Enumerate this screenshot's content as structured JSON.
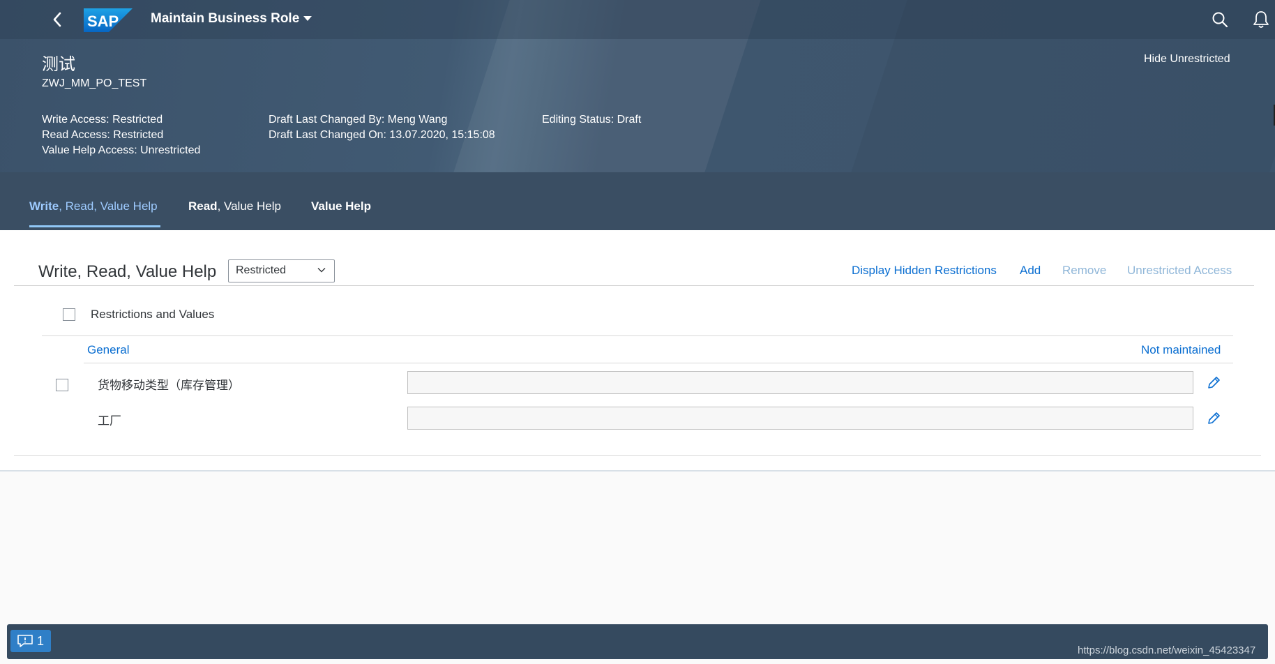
{
  "shell": {
    "app_title": "Maintain Business Role",
    "logo_text": "SAP",
    "icons": [
      "back-icon",
      "search-icon",
      "bell-icon",
      "user-icon"
    ]
  },
  "header": {
    "title": "测试",
    "subtitle": "ZWJ_MM_PO_TEST",
    "hide_button": "Hide Unrestricted",
    "write_access": "Write Access: Restricted",
    "read_access": "Read Access: Restricted",
    "value_help_access": "Value Help Access: Unrestricted",
    "draft_changed_by": "Draft Last Changed By: Meng Wang",
    "draft_changed_on": "Draft Last Changed On: 13.07.2020, 15:15:08",
    "editing_status": "Editing Status: Draft"
  },
  "tabs": [
    {
      "label": "Write, Read, Value Help",
      "selected": true
    },
    {
      "label": "Read, Value Help",
      "selected": false
    },
    {
      "label": "Value Help",
      "selected": false
    }
  ],
  "section": {
    "title": "Write, Read, Value Help",
    "select_value": "Restricted",
    "actions": {
      "display_hidden": "Display Hidden Restrictions",
      "add": "Add",
      "remove": "Remove",
      "unrestricted": "Unrestricted Access"
    },
    "table_header": "Restrictions and Values",
    "group": {
      "name": "General",
      "status": "Not maintained"
    },
    "rows": [
      {
        "label": "货物移动类型（库存管理）",
        "value": ""
      },
      {
        "label": "工厂",
        "value": ""
      }
    ]
  },
  "footer": {
    "message_count": "1",
    "watermark": "https://blog.csdn.net/weixin_45423347"
  },
  "colors": {
    "shell": "#354a5f",
    "accent": "#0a6ed1",
    "selected_tab": "#9ecbff"
  }
}
